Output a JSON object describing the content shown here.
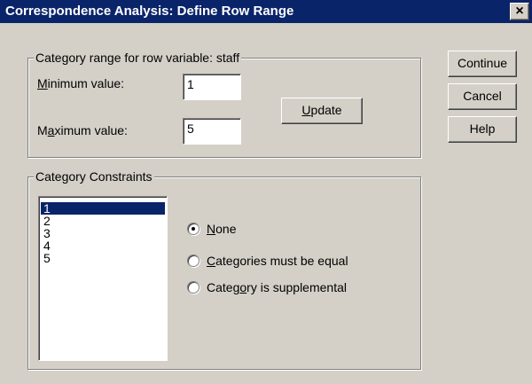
{
  "dialog": {
    "title": "Correspondence Analysis: Define Row Range",
    "close_glyph": "×"
  },
  "range_group": {
    "label": "Category range for row variable:  staff",
    "min_label": {
      "before": "",
      "mnemonic": "M",
      "after": "inimum value:"
    },
    "min_value": "1",
    "max_label": {
      "before": "M",
      "mnemonic": "a",
      "after": "ximum value:"
    },
    "max_value": "5",
    "update_button": {
      "before": "",
      "mnemonic": "U",
      "after": "pdate"
    }
  },
  "buttons": {
    "continue": "Continue",
    "cancel": "Cancel",
    "help": "Help"
  },
  "constraints_group": {
    "label": "Category Constraints",
    "categories": [
      "1",
      "2",
      "3",
      "4",
      "5"
    ],
    "selected_category": "1",
    "options": [
      {
        "before": "",
        "mnemonic": "N",
        "after": "one",
        "selected": true
      },
      {
        "before": "",
        "mnemonic": "C",
        "after": "ategories must be equal",
        "selected": false
      },
      {
        "before": "Categ",
        "mnemonic": "o",
        "after": "ry is supplemental",
        "selected": false
      }
    ]
  }
}
